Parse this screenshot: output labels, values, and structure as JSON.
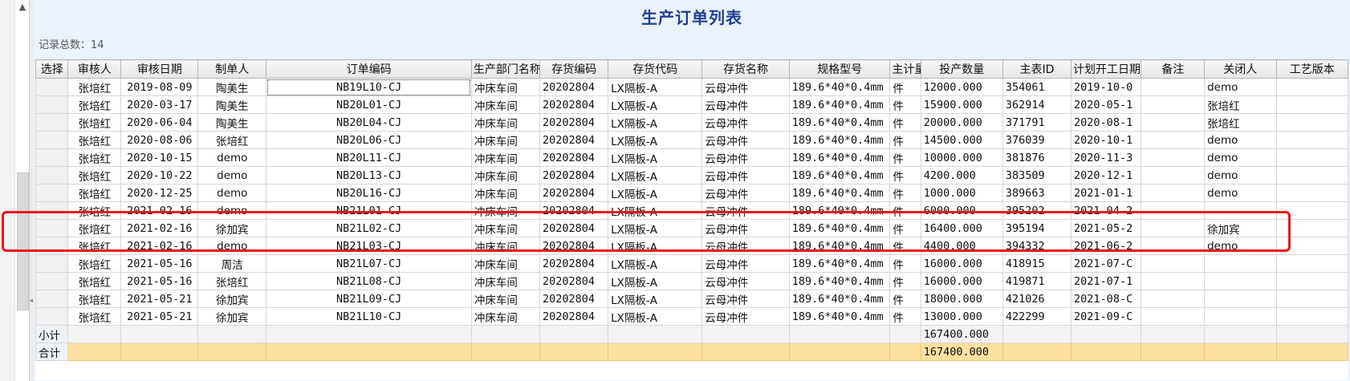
{
  "window": {
    "title": "生产订单列表",
    "record_count_label": "记录总数：14"
  },
  "columns": [
    "选择",
    "审核人",
    "审核日期",
    "制单人",
    "订单编码",
    "生产部门名称",
    "存货编码",
    "存货代码",
    "存货名称",
    "规格型号",
    "主计量单位",
    "投产数量",
    "主表ID",
    "计划开工日期",
    "备注",
    "关闭人",
    "工艺版本"
  ],
  "rows": [
    {
      "auditor": "张培红",
      "audit_date": "2019-08-09",
      "maker": "陶美生",
      "order_code": "NB19L10-CJ",
      "dept": "冲床车间",
      "inv_code": "20202804",
      "inv_key": "LX隔板-A",
      "inv_name": "云母冲件",
      "spec": "189.6*40*0.4mm",
      "unit": "件",
      "qty": "12000.000",
      "main_id": "354061",
      "start": "2019-10-0",
      "note": "",
      "closer": "demo",
      "ver": ""
    },
    {
      "auditor": "张培红",
      "audit_date": "2020-03-17",
      "maker": "陶美生",
      "order_code": "NB20L01-CJ",
      "dept": "冲床车间",
      "inv_code": "20202804",
      "inv_key": "LX隔板-A",
      "inv_name": "云母冲件",
      "spec": "189.6*40*0.4mm",
      "unit": "件",
      "qty": "15900.000",
      "main_id": "362914",
      "start": "2020-05-1",
      "note": "",
      "closer": "张培红",
      "ver": ""
    },
    {
      "auditor": "张培红",
      "audit_date": "2020-06-04",
      "maker": "陶美生",
      "order_code": "NB20L04-CJ",
      "dept": "冲床车间",
      "inv_code": "20202804",
      "inv_key": "LX隔板-A",
      "inv_name": "云母冲件",
      "spec": "189.6*40*0.4mm",
      "unit": "件",
      "qty": "20000.000",
      "main_id": "371791",
      "start": "2020-08-1",
      "note": "",
      "closer": "张培红",
      "ver": ""
    },
    {
      "auditor": "张培红",
      "audit_date": "2020-08-06",
      "maker": "张培红",
      "order_code": "NB20L06-CJ",
      "dept": "冲床车间",
      "inv_code": "20202804",
      "inv_key": "LX隔板-A",
      "inv_name": "云母冲件",
      "spec": "189.6*40*0.4mm",
      "unit": "件",
      "qty": "14500.000",
      "main_id": "376039",
      "start": "2020-10-1",
      "note": "",
      "closer": "demo",
      "ver": ""
    },
    {
      "auditor": "张培红",
      "audit_date": "2020-10-15",
      "maker": "demo",
      "order_code": "NB20L11-CJ",
      "dept": "冲床车间",
      "inv_code": "20202804",
      "inv_key": "LX隔板-A",
      "inv_name": "云母冲件",
      "spec": "189.6*40*0.4mm",
      "unit": "件",
      "qty": "10000.000",
      "main_id": "381876",
      "start": "2020-11-3",
      "note": "",
      "closer": "demo",
      "ver": ""
    },
    {
      "auditor": "张培红",
      "audit_date": "2020-10-22",
      "maker": "demo",
      "order_code": "NB20L13-CJ",
      "dept": "冲床车间",
      "inv_code": "20202804",
      "inv_key": "LX隔板-A",
      "inv_name": "云母冲件",
      "spec": "189.6*40*0.4mm",
      "unit": "件",
      "qty": "4200.000",
      "main_id": "383509",
      "start": "2020-12-1",
      "note": "",
      "closer": "demo",
      "ver": ""
    },
    {
      "auditor": "张培红",
      "audit_date": "2020-12-25",
      "maker": "demo",
      "order_code": "NB20L16-CJ",
      "dept": "冲床车间",
      "inv_code": "20202804",
      "inv_key": "LX隔板-A",
      "inv_name": "云母冲件",
      "spec": "189.6*40*0.4mm",
      "unit": "件",
      "qty": "1000.000",
      "main_id": "389663",
      "start": "2021-01-1",
      "note": "",
      "closer": "demo",
      "ver": ""
    },
    {
      "auditor": "张培红",
      "audit_date": "2021-02-16",
      "maker": "demo",
      "order_code": "NB21L01-CJ",
      "dept": "冲床车间",
      "inv_code": "20202804",
      "inv_key": "LX隔板-A",
      "inv_name": "云母冲件",
      "spec": "189.6*40*0.4mm",
      "unit": "件",
      "qty": "6000.000",
      "main_id": "395202",
      "start": "2021-04-2",
      "note": "",
      "closer": "",
      "ver": ""
    },
    {
      "auditor": "张培红",
      "audit_date": "2021-02-16",
      "maker": "徐加宾",
      "order_code": "NB21L02-CJ",
      "dept": "冲床车间",
      "inv_code": "20202804",
      "inv_key": "LX隔板-A",
      "inv_name": "云母冲件",
      "spec": "189.6*40*0.4mm",
      "unit": "件",
      "qty": "16400.000",
      "main_id": "395194",
      "start": "2021-05-2",
      "note": "",
      "closer": "徐加宾",
      "ver": ""
    },
    {
      "auditor": "张培红",
      "audit_date": "2021-02-16",
      "maker": "demo",
      "order_code": "NB21L03-CJ",
      "dept": "冲床车间",
      "inv_code": "20202804",
      "inv_key": "LX隔板-A",
      "inv_name": "云母冲件",
      "spec": "189.6*40*0.4mm",
      "unit": "件",
      "qty": "4400.000",
      "main_id": "394332",
      "start": "2021-06-2",
      "note": "",
      "closer": "demo",
      "ver": ""
    },
    {
      "auditor": "张培红",
      "audit_date": "2021-05-16",
      "maker": "周洁",
      "order_code": "NB21L07-CJ",
      "dept": "冲床车间",
      "inv_code": "20202804",
      "inv_key": "LX隔板-A",
      "inv_name": "云母冲件",
      "spec": "189.6*40*0.4mm",
      "unit": "件",
      "qty": "16000.000",
      "main_id": "418915",
      "start": "2021-07-C",
      "note": "",
      "closer": "",
      "ver": ""
    },
    {
      "auditor": "张培红",
      "audit_date": "2021-05-16",
      "maker": "张培红",
      "order_code": "NB21L08-CJ",
      "dept": "冲床车间",
      "inv_code": "20202804",
      "inv_key": "LX隔板-A",
      "inv_name": "云母冲件",
      "spec": "189.6*40*0.4mm",
      "unit": "件",
      "qty": "16000.000",
      "main_id": "419871",
      "start": "2021-07-1",
      "note": "",
      "closer": "",
      "ver": ""
    },
    {
      "auditor": "张培红",
      "audit_date": "2021-05-21",
      "maker": "徐加宾",
      "order_code": "NB21L09-CJ",
      "dept": "冲床车间",
      "inv_code": "20202804",
      "inv_key": "LX隔板-A",
      "inv_name": "云母冲件",
      "spec": "189.6*40*0.4mm",
      "unit": "件",
      "qty": "18000.000",
      "main_id": "421026",
      "start": "2021-08-C",
      "note": "",
      "closer": "",
      "ver": ""
    },
    {
      "auditor": "张培红",
      "audit_date": "2021-05-21",
      "maker": "徐加宾",
      "order_code": "NB21L10-CJ",
      "dept": "冲床车间",
      "inv_code": "20202804",
      "inv_key": "LX隔板-A",
      "inv_name": "云母冲件",
      "spec": "189.6*40*0.4mm",
      "unit": "件",
      "qty": "13000.000",
      "main_id": "422299",
      "start": "2021-09-C",
      "note": "",
      "closer": "",
      "ver": ""
    }
  ],
  "subtotal": {
    "label": "小计",
    "qty": "167400.000"
  },
  "total": {
    "label": "合计",
    "qty": "167400.000"
  },
  "colors": {
    "title": "#1f3f8f",
    "highlight": "#e8141c",
    "total_row": "#fde0a0",
    "panel_bg": "#eaf2fb"
  }
}
